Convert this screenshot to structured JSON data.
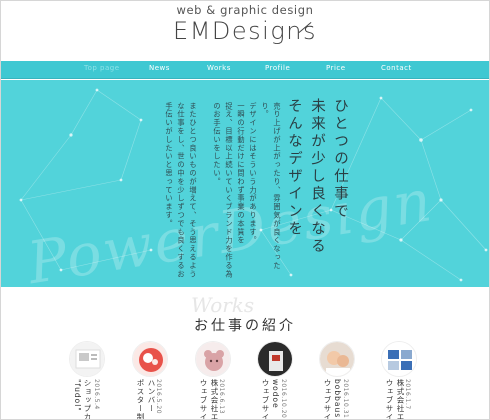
{
  "header": {
    "tagline": "web & graphic design",
    "logo": "EMDesigns"
  },
  "nav": {
    "items": [
      "Top page",
      "News",
      "Works",
      "Profile",
      "Price",
      "Contact"
    ]
  },
  "hero": {
    "headline": [
      "ひとつの仕事で",
      "未来が少し良くなる",
      "そんなデザインを"
    ],
    "body": [
      "売り上げが上がったり、雰囲気が良くなった",
      "り。",
      "デザインにはそういう力があります。",
      "一瞬の行動だけに問わず事業の本質を",
      "捉え、目標以上続いていくブランド力を作る為",
      "のお手伝いをしたい。",
      "",
      "またひとつ良いものが増えて、そう思えるよう",
      "な仕事をし、世の中を少しずつでも良くするお",
      "手伝いがしたいと思っています。"
    ],
    "script_text": "PowerDesign"
  },
  "works": {
    "bg_text": "Works",
    "title": "お仕事の紹介",
    "items": [
      {
        "date": "2016.5.4",
        "lines": [
          "ショップカ",
          "\"fudol\""
        ]
      },
      {
        "date": "2016.5.20",
        "lines": [
          "ハンバー",
          "ポスター制"
        ]
      },
      {
        "date": "2016.6.13",
        "lines": [
          "株式会社エ",
          "ウェブサイ"
        ]
      },
      {
        "date": "2016.10.20",
        "lines": [
          "wodoe",
          "ウェブサイ"
        ]
      },
      {
        "date": "2016.10.31",
        "lines": [
          "bobbaus",
          "ウェブサイ"
        ]
      },
      {
        "date": "2016.1.7",
        "lines": [
          "株式会社エ",
          "ウェブサイ"
        ]
      }
    ]
  }
}
